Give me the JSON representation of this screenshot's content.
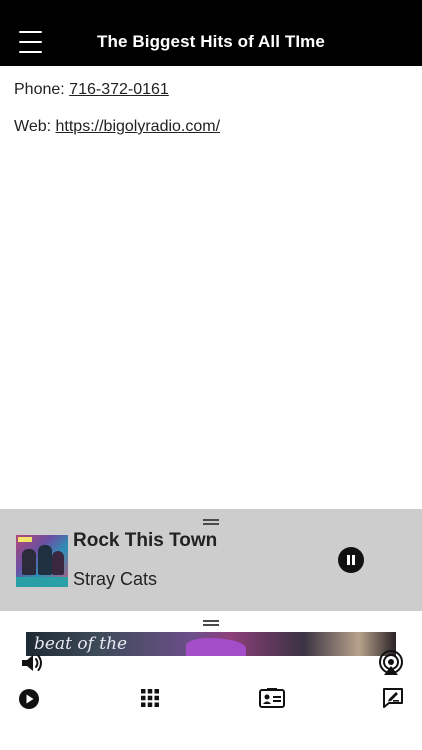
{
  "header": {
    "title": "The Biggest Hits of All TIme"
  },
  "contact": {
    "phone_label": "Phone:",
    "phone_value": "716-372-0161",
    "web_label": "Web:",
    "web_value": "https://bigolyradio.com/"
  },
  "now_playing": {
    "title": "Rock This Town",
    "artist": "Stray Cats"
  },
  "banner": {
    "text": "beat of the"
  },
  "icons": {
    "menu": "hamburger-menu-icon",
    "pause": "pause-circle-icon",
    "volume": "speaker-volume-icon",
    "airplay": "airplay-broadcast-icon",
    "play": "play-circle-icon",
    "grid": "grid-apps-icon",
    "contact": "contact-card-icon",
    "feedback": "edit-message-icon"
  }
}
